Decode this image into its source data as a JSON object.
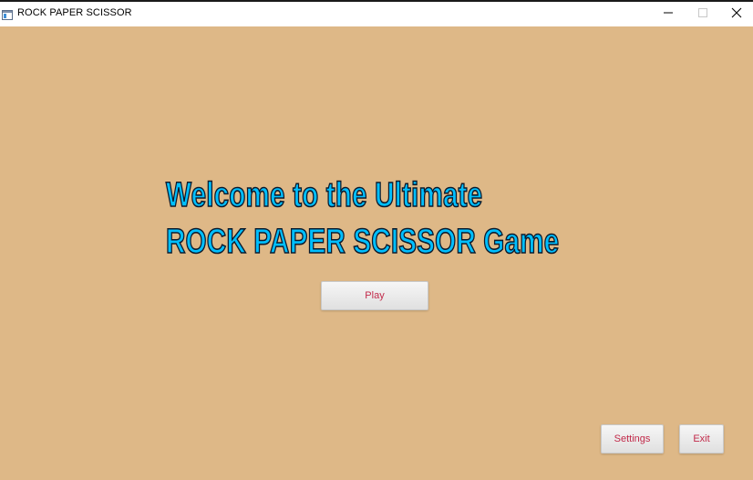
{
  "window": {
    "title": "ROCK PAPER SCISSOR",
    "icon": "app-window-icon",
    "controls": [
      "minimize-icon",
      "maximize-icon",
      "close-icon"
    ]
  },
  "main": {
    "headline_line1": "Welcome to the Ultimate",
    "headline_line2": "ROCK PAPER SCISSOR Game",
    "play_label": "Play"
  },
  "footer": {
    "settings_label": "Settings",
    "exit_label": "Exit"
  },
  "colors": {
    "background": "#deb887",
    "headline_fill": "#00bfff",
    "headline_outline": "#0d1a2b",
    "button_text": "#c22a4a"
  }
}
